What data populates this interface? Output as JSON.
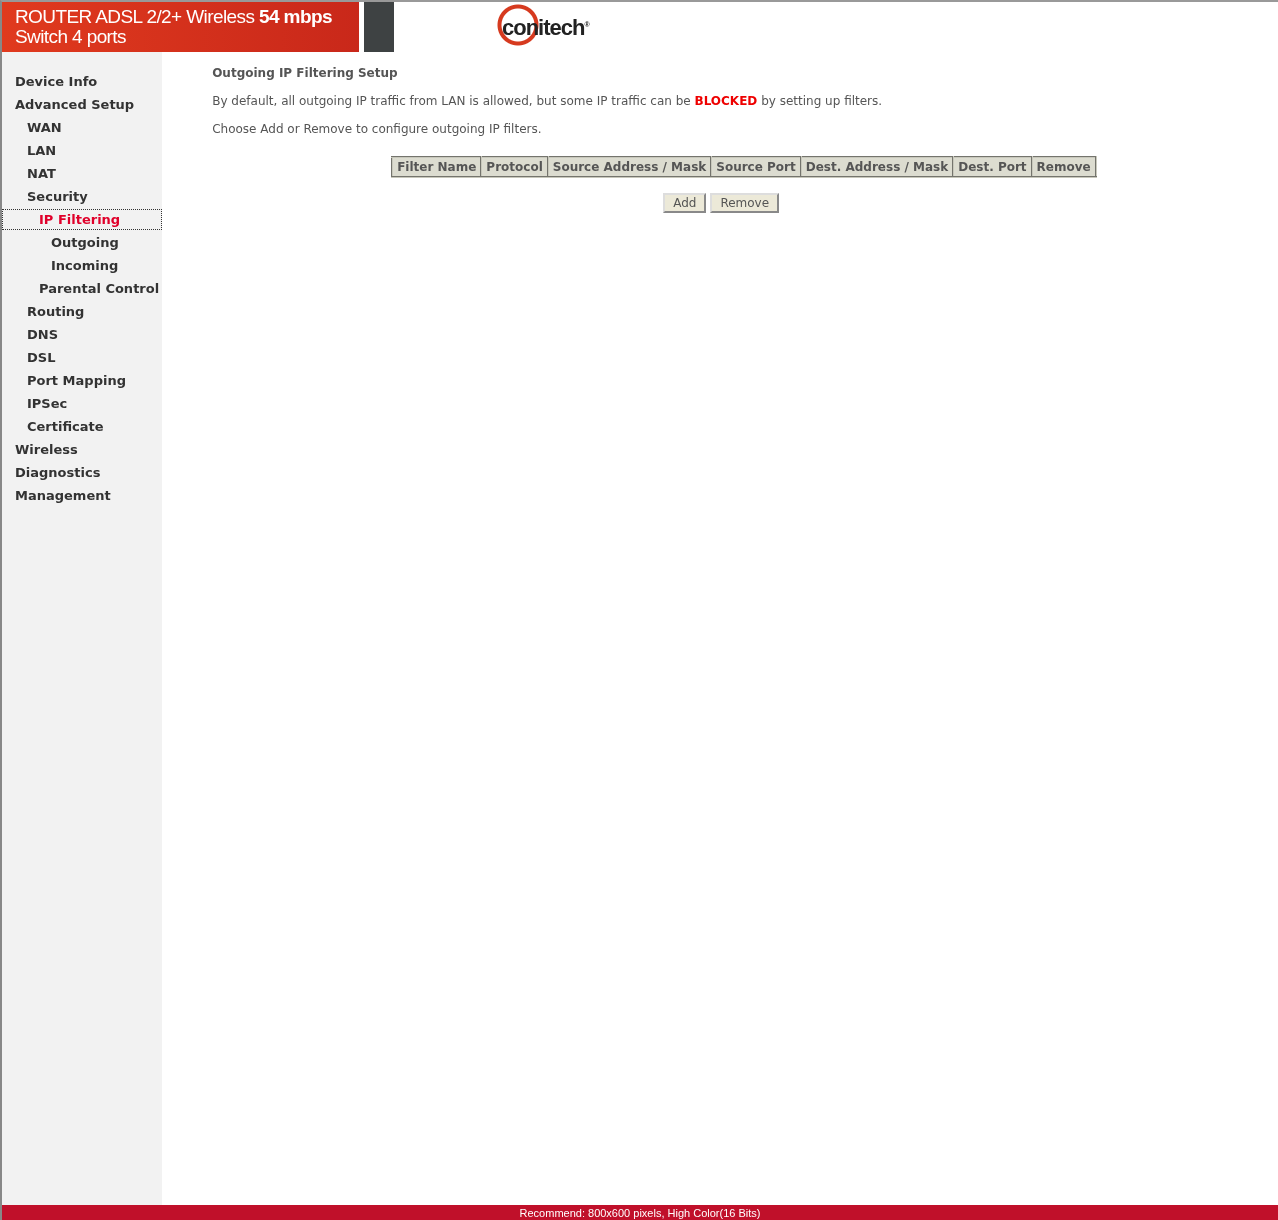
{
  "banner": {
    "line_1": "ROUTER ADSL 2/2+ Wireless",
    "speed": "54 mbps",
    "line_2": "Switch 4 ports"
  },
  "logo": {
    "text": "conitech",
    "mark": "®"
  },
  "menu": [
    {
      "label": "Device Info",
      "selected": false
    },
    {
      "label": "Advanced Setup",
      "selected": false,
      "children": [
        {
          "label": "WAN",
          "selected": false
        },
        {
          "label": "LAN",
          "selected": false
        },
        {
          "label": "NAT",
          "selected": false
        },
        {
          "label": "Security",
          "selected": false,
          "children": [
            {
              "label": "IP Filtering",
              "selected": true,
              "children": [
                {
                  "label": "Outgoing",
                  "selected": false
                },
                {
                  "label": "Incoming",
                  "selected": false
                }
              ]
            },
            {
              "label": "Parental Control",
              "selected": false
            }
          ]
        },
        {
          "label": "Routing",
          "selected": false
        },
        {
          "label": "DNS",
          "selected": false
        },
        {
          "label": "DSL",
          "selected": false
        },
        {
          "label": "Port Mapping",
          "selected": false
        },
        {
          "label": "IPSec",
          "selected": false
        },
        {
          "label": "Certificate",
          "selected": false
        }
      ]
    },
    {
      "label": "Wireless",
      "selected": false
    },
    {
      "label": "Diagnostics",
      "selected": false
    },
    {
      "label": "Management",
      "selected": false
    }
  ],
  "content": {
    "title": "Outgoing IP Filtering Setup",
    "intro": "By default, all outgoing IP traffic from LAN is allowed, but some IP traffic can be **BLOCKED** by setting up filters.",
    "instruction": "Choose Add or Remove to configure outgoing IP filters.",
    "table": {
      "columns": [
        "Filter Name",
        "Protocol",
        "Source Address / Mask",
        "Source Port",
        "Dest. Address / Mask",
        "Dest. Port",
        "Remove"
      ]
    },
    "buttons": [
      "Add",
      "Remove"
    ]
  },
  "status_bar": "Recommend: 800x600 pixels, High Color(16 Bits)"
}
